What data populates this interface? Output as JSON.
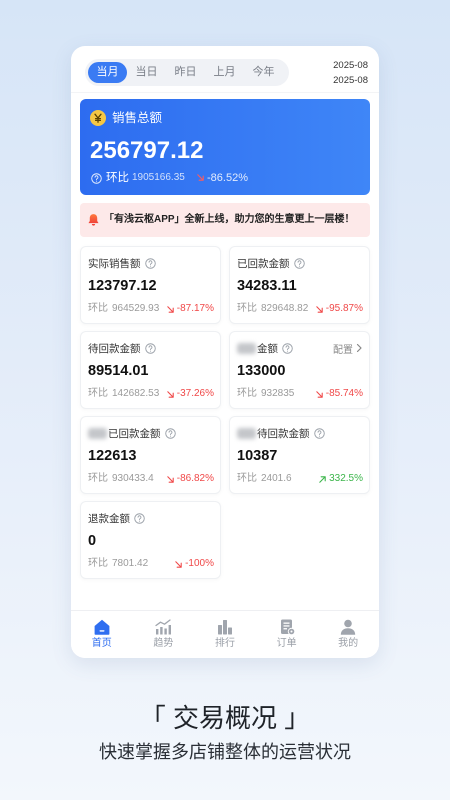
{
  "period_tabs": [
    {
      "label": "当月",
      "active": true
    },
    {
      "label": "当日",
      "active": false
    },
    {
      "label": "昨日",
      "active": false
    },
    {
      "label": "上月",
      "active": false
    },
    {
      "label": "今年",
      "active": false
    }
  ],
  "date_range": {
    "start": "2025-08",
    "end": "2025-08"
  },
  "summary": {
    "icon": "yen-icon",
    "title": "销售总额",
    "value": "256797.12",
    "compare_label": "环比",
    "compare_value": "1905166.35",
    "trend_icon": "trend-down-icon",
    "change": "-86.52%"
  },
  "notice": {
    "icon": "bell-icon",
    "text": "「有浅云枢APP」全新上线，助力您的生意更上一层楼！"
  },
  "stats": [
    {
      "label": "实际销售额",
      "value": "123797.12",
      "compare_label": "环比",
      "compare_value": "964529.93",
      "trend_icon": "trend-down-icon",
      "change": "-87.17%"
    },
    {
      "label": "已回款金额",
      "value": "34283.11",
      "compare_label": "环比",
      "compare_value": "829648.82",
      "trend_icon": "trend-down-icon",
      "change": "-95.87%"
    },
    {
      "label": "待回款金额",
      "value": "89514.01",
      "compare_label": "环比",
      "compare_value": "142682.53",
      "trend_icon": "trend-down-icon",
      "change": "-37.26%"
    },
    {
      "label": "金额",
      "action_label": "配置",
      "value": "133000",
      "compare_label": "环比",
      "compare_value": "932835",
      "trend_icon": "trend-down-icon",
      "change": "-85.74%"
    },
    {
      "label": "已回款金额",
      "value": "122613",
      "compare_label": "环比",
      "compare_value": "930433.4",
      "trend_icon": "trend-down-icon",
      "change": "-86.82%"
    },
    {
      "label": "待回款金额",
      "value": "10387",
      "compare_label": "环比",
      "compare_value": "2401.6",
      "trend_icon": "trend-up-icon",
      "change": "332.5%"
    },
    {
      "label": "退款金额",
      "value": "0",
      "compare_label": "环比",
      "compare_value": "7801.42",
      "trend_icon": "trend-down-icon",
      "change": "-100%"
    }
  ],
  "tabbar": [
    {
      "label": "首页",
      "icon": "home-icon",
      "active": true
    },
    {
      "label": "趋势",
      "icon": "trend-chart-icon",
      "active": false
    },
    {
      "label": "排行",
      "icon": "ranking-icon",
      "active": false
    },
    {
      "label": "订单",
      "icon": "order-icon",
      "active": false
    },
    {
      "label": "我的",
      "icon": "user-icon",
      "active": false
    }
  ],
  "caption": {
    "title": "「 交易概况 」",
    "subtitle": "快速掌握多店铺整体的运营状况"
  },
  "colors": {
    "accent": "#2f6ef0",
    "tab_active": "#3a7bf3",
    "summary_start": "#2d6cf0",
    "summary_end": "#3f86f7",
    "notice_bg": "#fde9e9",
    "down": "#f04848",
    "up": "#3bb54a"
  }
}
